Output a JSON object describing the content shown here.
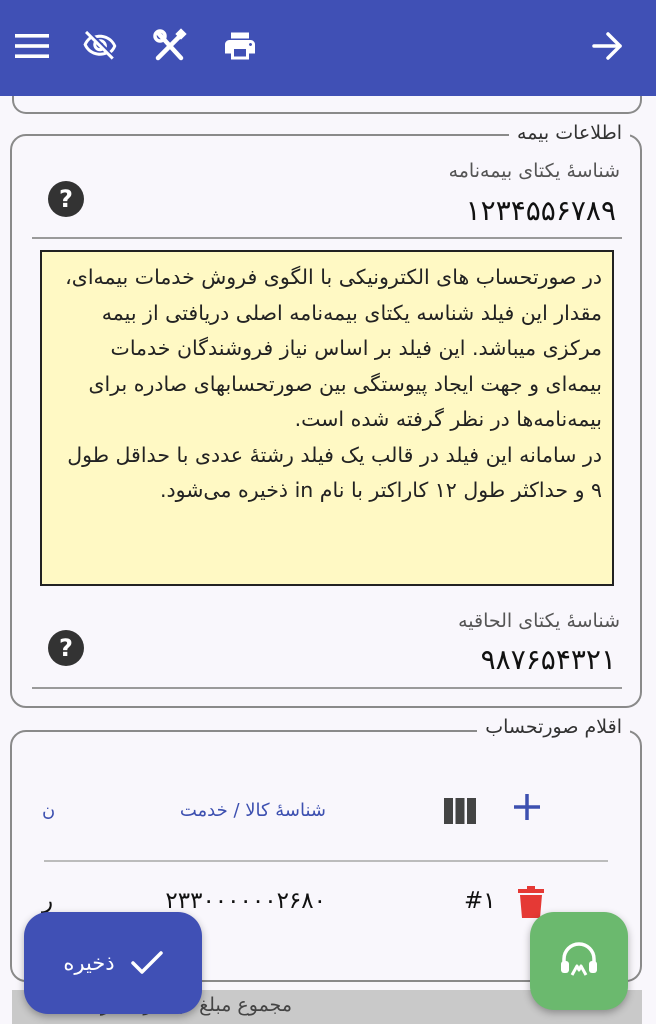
{
  "toolbar": {
    "icons": [
      "menu-icon",
      "visibility-off-icon",
      "tools-icon",
      "print-icon",
      "arrow-forward-icon"
    ]
  },
  "insurance_section": {
    "legend": "اطلاعات بیمه",
    "policy_id": {
      "label": "شناسهٔ یکتای بیمه‌نامه",
      "value": "۱۲۳۴۵۵۶۷۸۹"
    },
    "help_text": {
      "line1": "در صورتحساب های الکترونیکی با الگوی فروش خدمات بیمه‌ای، مقدار این فیلد شناسه یکتای بیمه‌نامه اصلی دریافتی از بیمه مرکزی میباشد. این فیلد بر اساس نیاز فروشندگان خدمات بیمه‌ای و جهت ایجاد پیوستگی بین صورتحسابهای صادره برای بیمه‌نامه‌ها در نظر گرفته شده است.",
      "line2": "در سامانه این فیلد در قالب یک فیلد رشتهٔ عددی با حداقل طول ۹ و حداکثر طول ۱۲ کاراکتر با نام in ذخیره می‌شود."
    },
    "endorsement_id": {
      "label": "شناسهٔ یکتای الحاقیه",
      "value": "۹۸۷۶۵۴۳۲۱"
    }
  },
  "items_section": {
    "legend": "اقلام صورتحساب",
    "column_header": "شناسهٔ کالا / خدمت",
    "truncated_header": "ن",
    "row": {
      "index": "#۱",
      "product_id": "۲۳۳۰۰۰۰۰۰۲۶۸۰",
      "truncated": "ر"
    }
  },
  "save_button": {
    "label": "ذخیره"
  },
  "footer": {
    "text": "مجموع مبلغ قبل از کسر تخفیف"
  },
  "colors": {
    "primary": "#4050b5",
    "help_bg": "#fff9c4",
    "delete": "#e53935",
    "support": "#6bb96e"
  }
}
